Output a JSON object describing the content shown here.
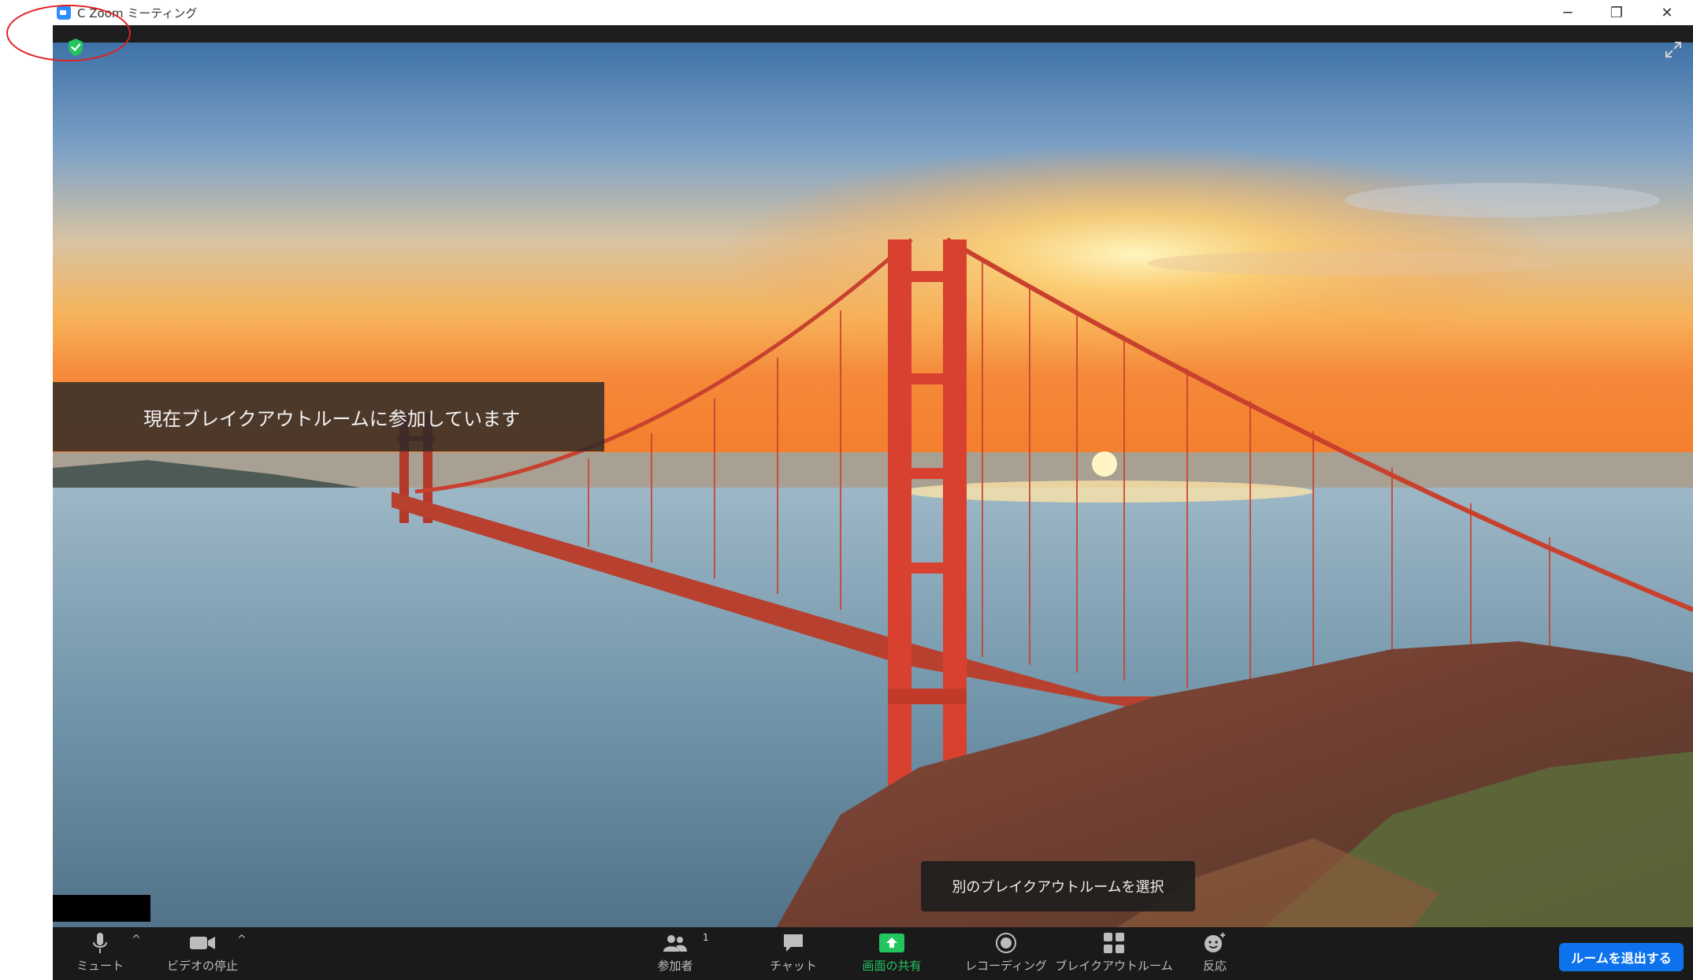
{
  "window": {
    "title": "C  Zoom ミーティング",
    "minimize": "─",
    "maximize": "❐",
    "close": "✕"
  },
  "meeting": {
    "banner_text": "現在ブレイクアウトルームに参加しています",
    "select_room_label": "別のブレイクアウトルームを選択",
    "security_icon": "shield-icon",
    "fullscreen_icon": "fullscreen-icon"
  },
  "toolbar": {
    "mute_label": "ミュート",
    "video_label": "ビデオの停止",
    "participants_label": "参加者",
    "participants_count": "1",
    "chat_label": "チャット",
    "share_label": "画面の共有",
    "record_label": "レコーディング",
    "breakout_label": "ブレイクアウトルーム",
    "reactions_label": "反応",
    "leave_label": "ルームを退出する",
    "caret": "^"
  },
  "colors": {
    "accent": "#0e72ed",
    "share_green": "#22c55e",
    "annotation_red": "#e02020"
  }
}
